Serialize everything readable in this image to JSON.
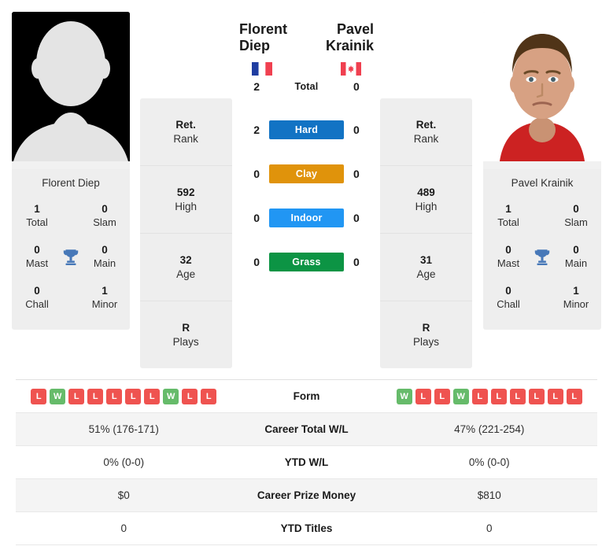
{
  "colors": {
    "win": "#66bb6a",
    "loss": "#ef5350",
    "hard": "#1273c4",
    "clay": "#e0930b",
    "indoor": "#2196f3",
    "grass": "#0c9444",
    "card_bg": "#eeeeee",
    "trophy": "#4778b8"
  },
  "players": {
    "left": {
      "name": "Florent Diep",
      "card_name": "Florent Diep",
      "flag": "france-flag-icon",
      "photo": "placeholder-avatar",
      "titles": [
        {
          "num": "1",
          "label": "Total"
        },
        {
          "num": "0",
          "label": "Slam"
        },
        {
          "num": "0",
          "label": "Mast"
        },
        {
          "num": "0",
          "label": "Main"
        },
        {
          "num": "0",
          "label": "Chall"
        },
        {
          "num": "1",
          "label": "Minor"
        }
      ],
      "stats": [
        {
          "num": "Ret.",
          "label": "Rank"
        },
        {
          "num": "592",
          "label": "High"
        },
        {
          "num": "32",
          "label": "Age"
        },
        {
          "num": "R",
          "label": "Plays"
        }
      ],
      "form": [
        "L",
        "W",
        "L",
        "L",
        "L",
        "L",
        "L",
        "W",
        "L",
        "L"
      ]
    },
    "right": {
      "name": "Pavel Krainik",
      "card_name": "Pavel Krainik",
      "flag": "canada-flag-icon",
      "photo": "player-photo",
      "titles": [
        {
          "num": "1",
          "label": "Total"
        },
        {
          "num": "0",
          "label": "Slam"
        },
        {
          "num": "0",
          "label": "Mast"
        },
        {
          "num": "0",
          "label": "Main"
        },
        {
          "num": "0",
          "label": "Chall"
        },
        {
          "num": "1",
          "label": "Minor"
        }
      ],
      "stats": [
        {
          "num": "Ret.",
          "label": "Rank"
        },
        {
          "num": "489",
          "label": "High"
        },
        {
          "num": "31",
          "label": "Age"
        },
        {
          "num": "R",
          "label": "Plays"
        }
      ],
      "form": [
        "W",
        "L",
        "L",
        "W",
        "L",
        "L",
        "L",
        "L",
        "L",
        "L"
      ]
    }
  },
  "h2h": [
    {
      "left": "2",
      "label": "Total",
      "right": "0",
      "surface": false
    },
    {
      "left": "2",
      "label": "Hard",
      "right": "0",
      "surface": true,
      "color": "#1273c4"
    },
    {
      "left": "0",
      "label": "Clay",
      "right": "0",
      "surface": true,
      "color": "#e0930b"
    },
    {
      "left": "0",
      "label": "Indoor",
      "right": "0",
      "surface": true,
      "color": "#2196f3"
    },
    {
      "left": "0",
      "label": "Grass",
      "right": "0",
      "surface": true,
      "color": "#0c9444"
    }
  ],
  "table": [
    {
      "label": "Form",
      "left": "",
      "right": "",
      "is_form": true
    },
    {
      "label": "Career Total W/L",
      "left": "51% (176-171)",
      "right": "47% (221-254)"
    },
    {
      "label": "YTD W/L",
      "left": "0% (0-0)",
      "right": "0% (0-0)"
    },
    {
      "label": "Career Prize Money",
      "left": "$0",
      "right": "$810"
    },
    {
      "label": "YTD Titles",
      "left": "0",
      "right": "0"
    }
  ]
}
